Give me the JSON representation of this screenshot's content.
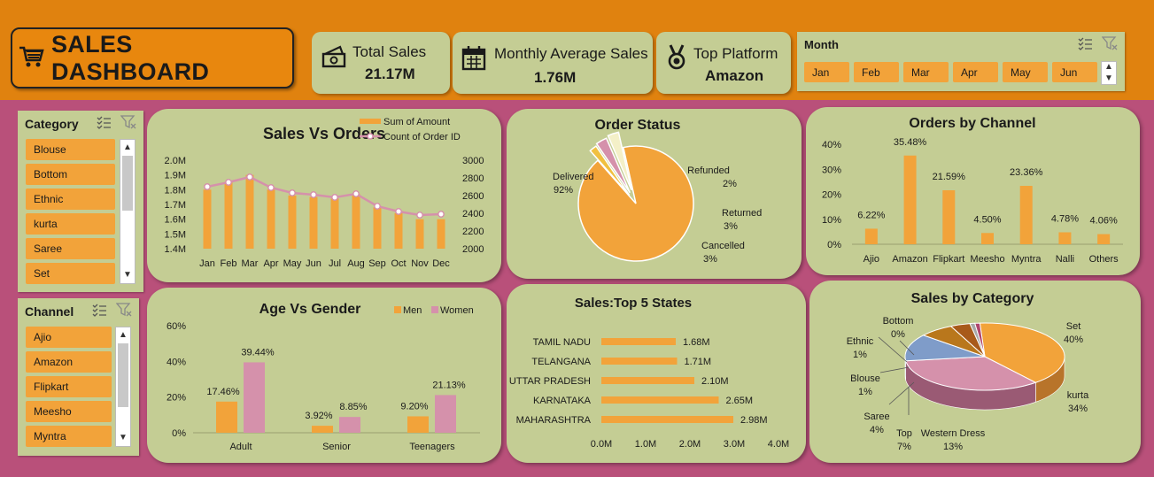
{
  "dashboard": {
    "title": "SALES DASHBOARD"
  },
  "kpis": {
    "total_sales": {
      "label": "Total Sales",
      "value": "21.17M"
    },
    "monthly_avg": {
      "label": "Monthly Average Sales",
      "value": "1.76M"
    },
    "top_platform": {
      "label": "Top Platform",
      "value": "Amazon"
    }
  },
  "month_slicer": {
    "header": "Month",
    "items": [
      "Jan",
      "Feb",
      "Mar",
      "Apr",
      "May",
      "Jun"
    ]
  },
  "category_slicer": {
    "header": "Category",
    "items": [
      "Blouse",
      "Bottom",
      "Ethnic",
      "kurta",
      "Saree",
      "Set"
    ]
  },
  "channel_slicer": {
    "header": "Channel",
    "items": [
      "Ajio",
      "Amazon",
      "Flipkart",
      "Meesho",
      "Myntra"
    ]
  },
  "colors": {
    "orange": "#f2a33a",
    "pink": "#d591ab",
    "panel": "#c4cd94",
    "background": "#b9507a",
    "topbar": "#e0820f"
  },
  "icons": {
    "title": "cart-icon",
    "total_sales": "money-icon",
    "monthly_avg": "calendar-icon",
    "top_platform": "medal-icon"
  },
  "chart_data": [
    {
      "id": "sales_vs_orders",
      "type": "bar",
      "title": "Sales Vs Orders",
      "categories": [
        "Jan",
        "Feb",
        "Mar",
        "Apr",
        "May",
        "Jun",
        "Jul",
        "Aug",
        "Sep",
        "Oct",
        "Nov",
        "Dec"
      ],
      "series": [
        {
          "name": "Sum of Amount",
          "type": "bar",
          "axis": "left",
          "values": [
            1.8,
            1.85,
            1.9,
            1.8,
            1.76,
            1.75,
            1.74,
            1.77,
            1.68,
            1.64,
            1.6,
            1.6
          ]
        },
        {
          "name": "Count of Order ID",
          "type": "line",
          "axis": "right",
          "values": [
            2700,
            2750,
            2810,
            2690,
            2630,
            2610,
            2580,
            2620,
            2480,
            2420,
            2380,
            2390
          ]
        }
      ],
      "y_left": {
        "ticks": [
          "1.4M",
          "1.5M",
          "1.6M",
          "1.7M",
          "1.8M",
          "1.9M",
          "2.0M"
        ],
        "min": 1.4,
        "max": 2.0
      },
      "y_right": {
        "ticks": [
          "2000",
          "2200",
          "2400",
          "2600",
          "2800",
          "3000"
        ],
        "min": 2000,
        "max": 3000
      }
    },
    {
      "id": "order_status",
      "type": "pie",
      "title": "Order Status",
      "slices": [
        {
          "name": "Delivered",
          "value": 92,
          "label": "92%"
        },
        {
          "name": "Refunded",
          "value": 2,
          "label": "2%"
        },
        {
          "name": "Returned",
          "value": 3,
          "label": "3%"
        },
        {
          "name": "Cancelled",
          "value": 3,
          "label": "3%"
        }
      ]
    },
    {
      "id": "orders_by_channel",
      "type": "bar",
      "title": "Orders by Channel",
      "categories": [
        "Ajio",
        "Amazon",
        "Flipkart",
        "Meesho",
        "Myntra",
        "Nalli",
        "Others"
      ],
      "values": [
        6.22,
        35.48,
        21.59,
        4.5,
        23.36,
        4.78,
        4.06
      ],
      "labels": [
        "6.22%",
        "35.48%",
        "21.59%",
        "4.50%",
        "23.36%",
        "4.78%",
        "4.06%"
      ],
      "y_ticks": [
        "0%",
        "10%",
        "20%",
        "30%",
        "40%"
      ],
      "ylim": [
        0,
        40
      ]
    },
    {
      "id": "age_vs_gender",
      "type": "bar",
      "title": "Age Vs Gender",
      "categories": [
        "Adult",
        "Senior",
        "Teenagers"
      ],
      "series": [
        {
          "name": "Men",
          "values": [
            17.46,
            3.92,
            9.2
          ],
          "labels": [
            "17.46%",
            "3.92%",
            "9.20%"
          ]
        },
        {
          "name": "Women",
          "values": [
            39.44,
            8.85,
            21.13
          ],
          "labels": [
            "39.44%",
            "8.85%",
            "21.13%"
          ]
        }
      ],
      "y_ticks": [
        "0%",
        "20%",
        "40%",
        "60%"
      ],
      "ylim": [
        0,
        60
      ]
    },
    {
      "id": "top_states",
      "type": "bar",
      "orientation": "horizontal",
      "title": "Sales:Top 5 States",
      "categories": [
        "TAMIL NADU",
        "TELANGANA",
        "UTTAR PRADESH",
        "KARNATAKA",
        "MAHARASHTRA"
      ],
      "values": [
        1.68,
        1.71,
        2.1,
        2.65,
        2.98
      ],
      "labels": [
        "1.68M",
        "1.71M",
        "2.10M",
        "2.65M",
        "2.98M"
      ],
      "x_ticks": [
        "0.0M",
        "1.0M",
        "2.0M",
        "3.0M",
        "4.0M"
      ],
      "xlim": [
        0,
        4
      ]
    },
    {
      "id": "sales_by_category",
      "type": "pie",
      "title": "Sales by Category",
      "slices": [
        {
          "name": "Set",
          "value": 40,
          "label": "40%"
        },
        {
          "name": "kurta",
          "value": 34,
          "label": "34%"
        },
        {
          "name": "Western Dress",
          "value": 13,
          "label": "13%"
        },
        {
          "name": "Top",
          "value": 7,
          "label": "7%"
        },
        {
          "name": "Saree",
          "value": 4,
          "label": "4%"
        },
        {
          "name": "Blouse",
          "value": 1,
          "label": "1%"
        },
        {
          "name": "Ethnic",
          "value": 1,
          "label": "1%"
        },
        {
          "name": "Bottom",
          "value": 0,
          "label": "0%"
        }
      ]
    }
  ]
}
